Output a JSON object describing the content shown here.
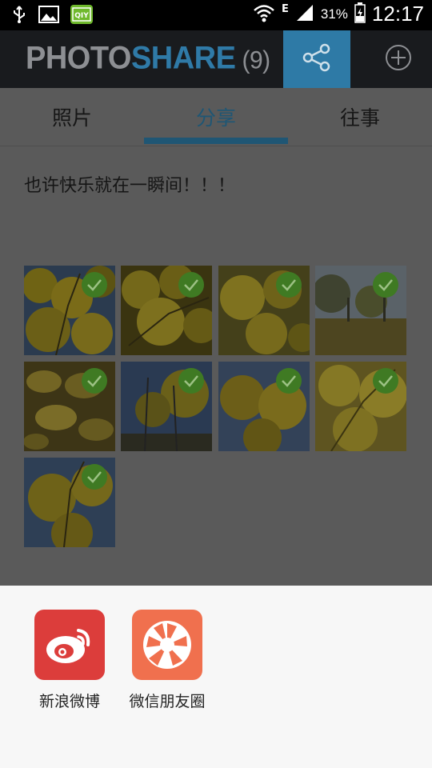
{
  "status": {
    "battery": "31%",
    "time": "12:17",
    "network": "E"
  },
  "app": {
    "title_part1": "PHOTO",
    "title_part2": "SHARE",
    "count": "(9)"
  },
  "tabs": [
    {
      "label": "照片"
    },
    {
      "label": "分享"
    },
    {
      "label": "往事"
    }
  ],
  "caption": "也许快乐就在一瞬间！！！",
  "photos": [
    {
      "style": "yellow-leaves-sky",
      "selected": true
    },
    {
      "style": "yellow-leaves-dense",
      "selected": true
    },
    {
      "style": "yellow-leaves-close",
      "selected": true
    },
    {
      "style": "park-trees-ground",
      "selected": true
    },
    {
      "style": "fallen-leaves",
      "selected": true
    },
    {
      "style": "tall-trees-sky",
      "selected": true
    },
    {
      "style": "yellow-canopy",
      "selected": true
    },
    {
      "style": "bright-yellow-branches",
      "selected": true
    },
    {
      "style": "yellow-tree-sky",
      "selected": true
    }
  ],
  "share_targets": [
    {
      "label": "新浪微博",
      "icon": "weibo-icon",
      "color": "#dc3d3b"
    },
    {
      "label": "微信朋友圈",
      "icon": "aperture-icon",
      "color": "#f0704e"
    }
  ],
  "colors": {
    "accent": "#2e7aa6",
    "check": "#4d8a2e"
  }
}
